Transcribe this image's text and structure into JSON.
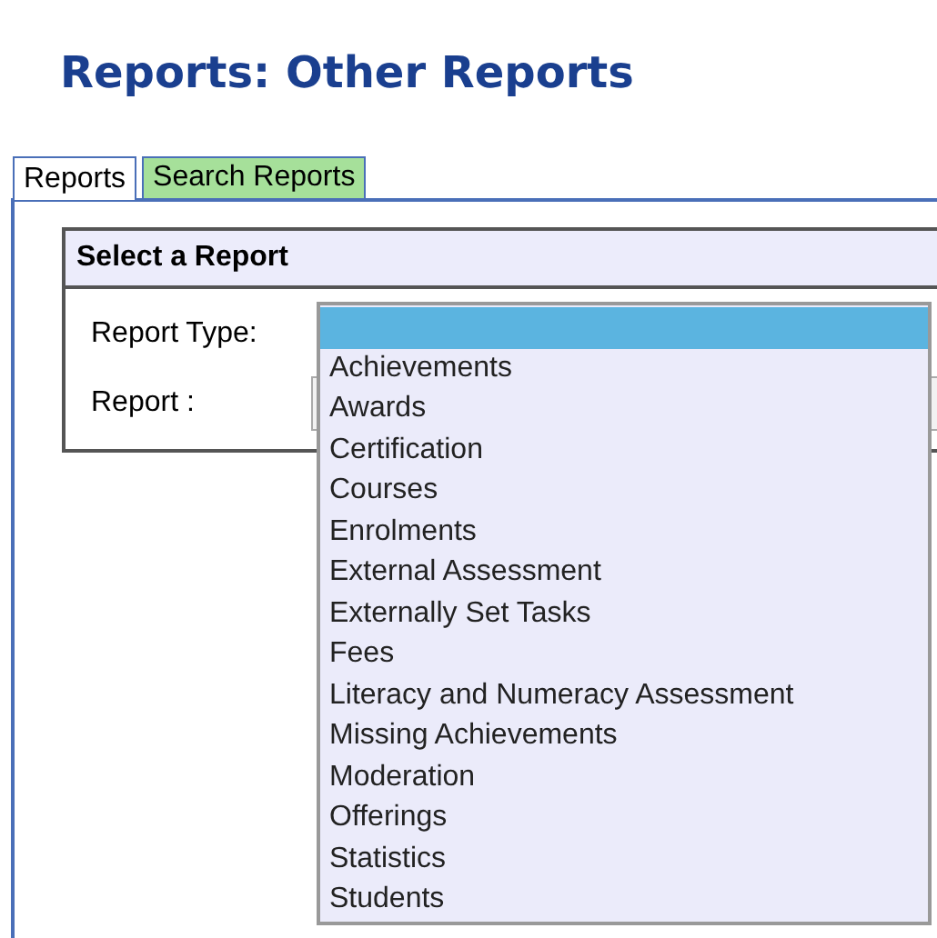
{
  "page_title": "Reports: Other Reports",
  "tabs": [
    {
      "label": "Reports",
      "selected": true
    },
    {
      "label": "Search Reports",
      "selected": false
    }
  ],
  "panel": {
    "title": "Select a Report",
    "fields": [
      {
        "label": "Report Type:",
        "open": true
      },
      {
        "label": "Report :",
        "open": false
      }
    ]
  },
  "dropdown": {
    "options": [
      {
        "selected": true
      },
      {
        "label": "Achievements",
        "selected": false
      },
      {
        "label": "Awards",
        "selected": false
      },
      {
        "label": "Certification",
        "selected": false
      },
      {
        "label": "Courses",
        "selected": false
      },
      {
        "label": "Enrolments",
        "selected": false
      },
      {
        "label": "External Assessment",
        "selected": false
      },
      {
        "label": "Externally Set Tasks",
        "selected": false
      },
      {
        "label": "Fees",
        "selected": false
      },
      {
        "label": "Literacy and Numeracy Assessment",
        "selected": false
      },
      {
        "label": "Missing Achievements",
        "selected": false
      },
      {
        "label": "Moderation",
        "selected": false
      },
      {
        "label": "Offerings",
        "selected": false
      },
      {
        "label": "Statistics",
        "selected": false
      },
      {
        "label": "Students",
        "selected": false
      }
    ]
  }
}
